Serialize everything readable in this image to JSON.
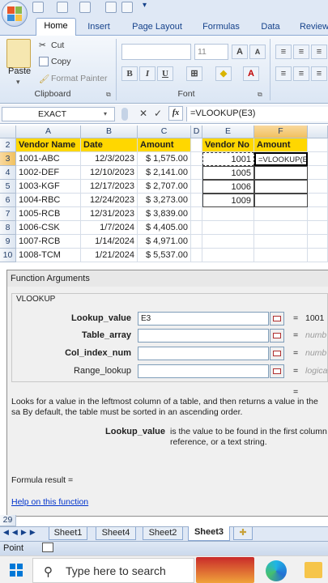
{
  "tabs": [
    "Home",
    "Insert",
    "Page Layout",
    "Formulas",
    "Data",
    "Review"
  ],
  "active_tab": "Home",
  "ribbon": {
    "clipboard": {
      "paste": "Paste",
      "cut": "Cut",
      "copy": "Copy",
      "format_painter": "Format Painter",
      "label": "Clipboard"
    },
    "font": {
      "size": "11",
      "bold": "B",
      "italic": "I",
      "underline": "U",
      "label": "Font"
    }
  },
  "formula_bar": {
    "name_box": "EXACT",
    "cancel": "✕",
    "enter": "✓",
    "fx": "fx",
    "formula": "=VLOOKUP(E3)"
  },
  "columns": [
    "A",
    "B",
    "C",
    "D",
    "E",
    "F"
  ],
  "rows": [
    "2",
    "3",
    "4",
    "5",
    "6",
    "7",
    "8",
    "9",
    "10"
  ],
  "table": {
    "headers": [
      "Vendor Name",
      "Date",
      "Amount"
    ],
    "rows": [
      [
        "1001-ABC",
        "12/3/2023",
        "$ 1,575.00"
      ],
      [
        "1002-DEF",
        "12/10/2023",
        "$ 2,141.00"
      ],
      [
        "1003-KGF",
        "12/17/2023",
        "$ 2,707.00"
      ],
      [
        "1004-RBC",
        "12/24/2023",
        "$ 3,273.00"
      ],
      [
        "1005-RCB",
        "12/31/2023",
        "$ 3,839.00"
      ],
      [
        "1006-CSK",
        "1/7/2024",
        "$ 4,405.00"
      ],
      [
        "1007-RCB",
        "1/14/2024",
        "$ 4,971.00"
      ],
      [
        "1008-TCM",
        "1/21/2024",
        "$ 5,537.00"
      ]
    ]
  },
  "lookup": {
    "headers": [
      "Vendor No",
      "Amount"
    ],
    "values": [
      "1001",
      "1005",
      "1006",
      "1009"
    ],
    "f3": "=VLOOKUP(E3)"
  },
  "dialog": {
    "title": "Function Arguments",
    "function": "VLOOKUP",
    "args": [
      {
        "label": "Lookup_value",
        "value": "E3",
        "result": "1001",
        "bold": true
      },
      {
        "label": "Table_array",
        "value": "",
        "result": "numb",
        "bold": true
      },
      {
        "label": "Col_index_num",
        "value": "",
        "result": "numb",
        "bold": true
      },
      {
        "label": "Range_lookup",
        "value": "",
        "result": "logica",
        "bold": false
      }
    ],
    "eq": "=",
    "description": "Looks for a value in the leftmost column of a table, and then returns a value in the sa By default, the table must be sorted in an ascending order.",
    "arg_name": "Lookup_value",
    "arg_desc": "is the value to be found in the first column reference, or a text string.",
    "formula_result": "Formula result =",
    "help_link": "Help on this function",
    "row_29": "29"
  },
  "sheet_tabs": [
    "Sheet1",
    "Sheet4",
    "Sheet2",
    "Sheet3"
  ],
  "active_sheet": "Sheet3",
  "status": "Point",
  "taskbar": {
    "search_placeholder": "Type here to search"
  }
}
